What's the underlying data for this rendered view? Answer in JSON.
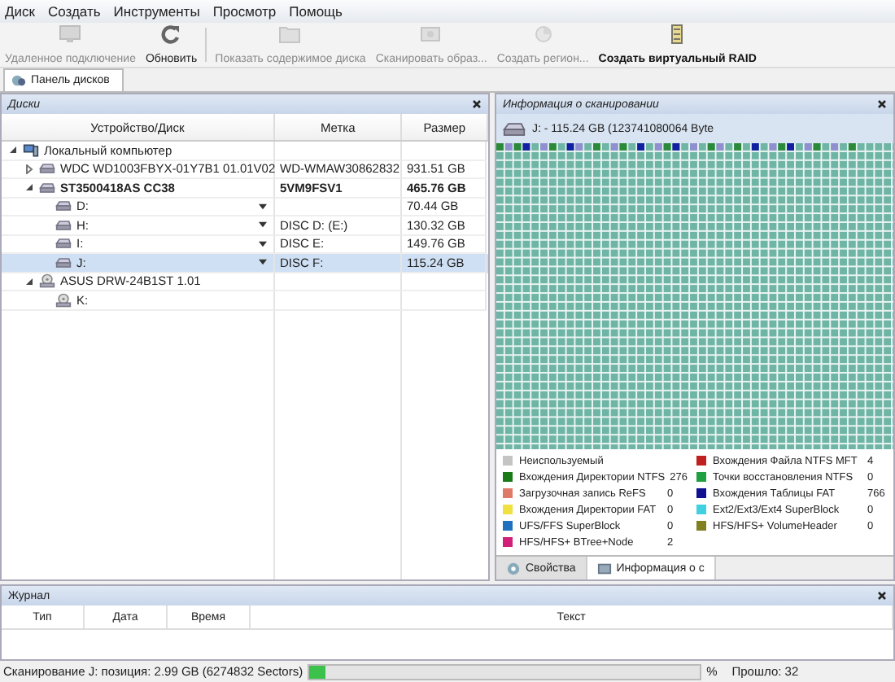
{
  "menu": [
    "Диск",
    "Создать",
    "Инструменты",
    "Просмотр",
    "Помощь"
  ],
  "toolbar": [
    {
      "label": "Удаленное подключение",
      "disabled": true
    },
    {
      "label": "Обновить",
      "disabled": false
    },
    {
      "label": "Показать содержимое диска",
      "disabled": true
    },
    {
      "label": "Сканировать образ...",
      "disabled": true
    },
    {
      "label": "Создать регион...",
      "disabled": true
    },
    {
      "label": "Создать виртуальный RAID",
      "disabled": false
    }
  ],
  "doc_tabs": [
    {
      "label": "Панель дисков",
      "selected": true
    }
  ],
  "disks_panel": {
    "title": "Диски",
    "columns": [
      "Устройство/Диск",
      "Метка",
      "Размер"
    ],
    "tree": [
      {
        "name": "Локальный компьютер",
        "kind": "computer",
        "expanded": true,
        "selected": false,
        "bold": false,
        "children": [
          {
            "name": "WDC WD1003FBYX-01Y7B1 01.01V02",
            "kind": "disk",
            "expanded": false,
            "selected": false,
            "bold": false,
            "label": "WD-WMAW30862832",
            "size": "931.51 GB"
          },
          {
            "name": "ST3500418AS CC38",
            "kind": "disk",
            "expanded": true,
            "selected": false,
            "bold": true,
            "label": "5VM9FSV1",
            "size": "465.76 GB",
            "children": [
              {
                "name": "D:",
                "kind": "volume",
                "selected": false,
                "bold": false,
                "size": "70.44 GB"
              },
              {
                "name": "H:",
                "kind": "volume",
                "selected": false,
                "bold": false,
                "label": "DISC D: (E:)",
                "size": "130.32 GB"
              },
              {
                "name": "I:",
                "kind": "volume",
                "selected": false,
                "bold": false,
                "label": "DISC E:",
                "size": "149.76 GB"
              },
              {
                "name": "J:",
                "kind": "volume",
                "selected": true,
                "bold": false,
                "label": "DISC F:",
                "size": "115.24 GB"
              }
            ]
          },
          {
            "name": "ASUS DRW-24B1ST 1.01",
            "kind": "optical",
            "expanded": true,
            "selected": false,
            "bold": false,
            "children": [
              {
                "name": "K:",
                "kind": "optical",
                "selected": false,
                "bold": false
              }
            ]
          }
        ]
      }
    ]
  },
  "scan_panel": {
    "title": "Информация о сканировании",
    "drive": "J: - 115.24 GB (123741080064 Byte",
    "legend": [
      {
        "label": "Неиспользуемый",
        "color": "#c4c4c4"
      },
      {
        "label": "Вхождения Директории NTFS",
        "count": "276",
        "color": "#1a7a1a"
      },
      {
        "label": "Загрузочная запись ReFS",
        "count": "0",
        "color": "#e07a68"
      },
      {
        "label": "Вхождения Директории FAT",
        "count": "0",
        "color": "#f0e040"
      },
      {
        "label": "UFS/FFS SuperBlock",
        "count": "0",
        "color": "#2070c0"
      },
      {
        "label": "HFS/HFS+ BTree+Node",
        "count": "2",
        "color": "#d0207a"
      },
      {
        "label": "Вхождения Файла NTFS MFT",
        "count": "4",
        "color": "#c02020"
      },
      {
        "label": "Точки восстановления NTFS",
        "count": "0",
        "color": "#20a040"
      },
      {
        "label": "Вхождения Таблицы FAT",
        "count": "766",
        "color": "#101090"
      },
      {
        "label": "Ext2/Ext3/Ext4 SuperBlock",
        "count": "0",
        "color": "#40d0e0"
      },
      {
        "label": "HFS/HFS+ VolumeHeader",
        "count": "0",
        "color": "#808020"
      }
    ],
    "tabs": [
      {
        "label": "Свойства",
        "selected": false
      },
      {
        "label": "Информация о с",
        "selected": true
      }
    ]
  },
  "journal": {
    "title": "Журнал",
    "columns": [
      "Тип",
      "Дата",
      "Время",
      "Текст"
    ]
  },
  "status_bar": {
    "text": "Сканирование J: позиция: 2.99 GB (6274832 Sectors)",
    "level": 0.04,
    "percent": "%",
    "elapsed": "Прошло: 32"
  }
}
